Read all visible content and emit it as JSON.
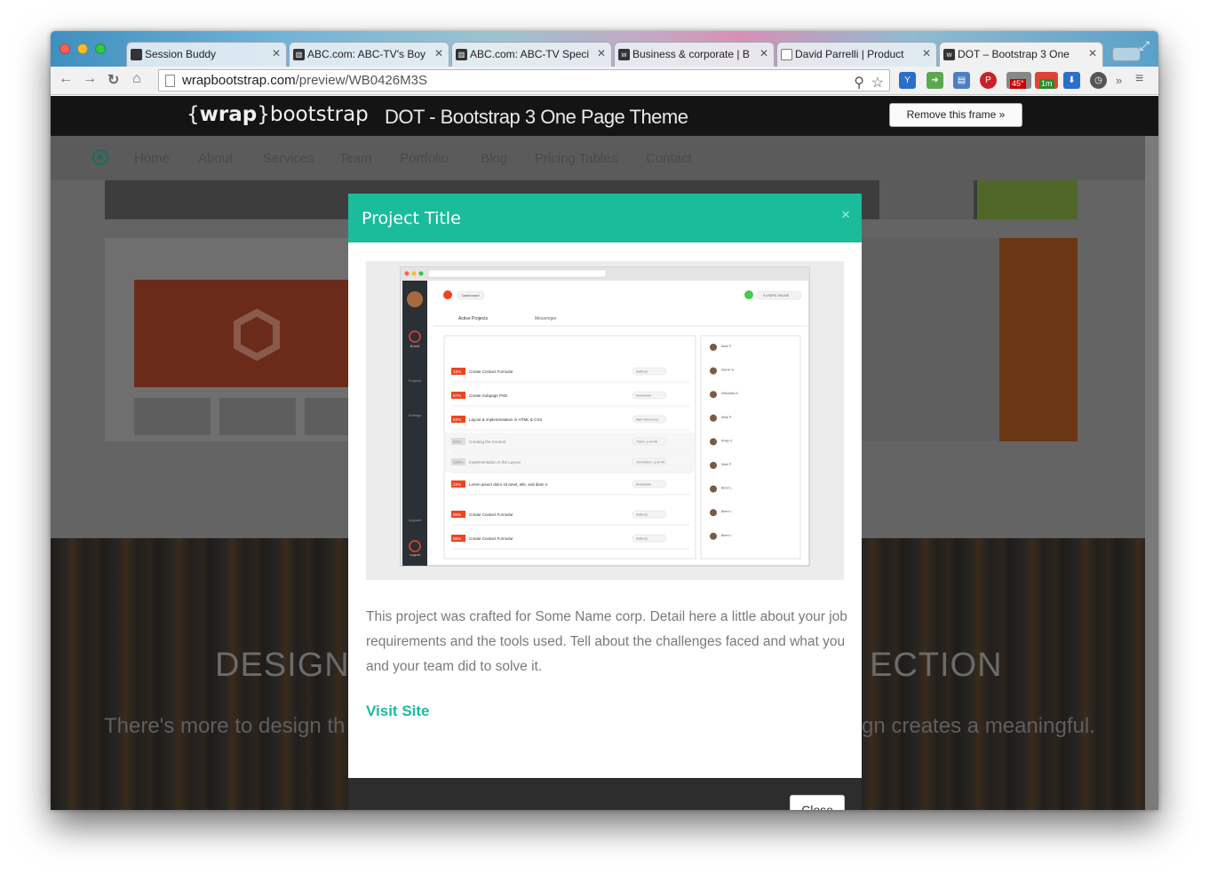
{
  "browser": {
    "tabs": [
      {
        "title": "Session Buddy",
        "icon": "session-icon"
      },
      {
        "title": "ABC.com: ABC-TV's Boy",
        "icon": "columns-icon"
      },
      {
        "title": "ABC.com: ABC-TV Speci",
        "icon": "columns-icon"
      },
      {
        "title": "Business & corporate | B",
        "icon": "wrap-icon"
      },
      {
        "title": "David Parrelli | Product",
        "icon": "doc-icon"
      },
      {
        "title": "DOT – Bootstrap 3 One",
        "icon": "wrap-icon"
      }
    ],
    "url_host": "wrapbootstrap.com",
    "url_path": "/preview/WB0426M3S",
    "ext_badges": {
      "weather": "45°",
      "timer": "1m"
    }
  },
  "wrap": {
    "logo_brace_open": "{",
    "logo_bold": "wrap",
    "logo_brace_close": "}",
    "logo_rest": "bootstrap",
    "title": "DOT - Bootstrap 3 One Page Theme",
    "remove_frame": "Remove this frame »"
  },
  "site": {
    "nav": [
      "Home",
      "About",
      "Services",
      "Team",
      "Portfolio",
      "Blog",
      "Pricing Tables",
      "Contact"
    ],
    "hero_heading_left": "DESIGN",
    "hero_heading_right": "ECTION",
    "hero_text_left": "There's more to design th",
    "hero_text_right": "gn creates a meaningful."
  },
  "modal": {
    "title": "Project Title",
    "close_x": "×",
    "description": "This project was crafted for Some Name corp. Detail here a little about your job requirements and the tools used. Tell about the challenges faced and what you and your team did to solve it.",
    "visit_label": "Visit Site",
    "close_label": "Close"
  },
  "screenshot": {
    "sidebar": [
      "Board",
      "Projects",
      "Settings",
      "Upgrade",
      "Logout"
    ],
    "tab_dashboard": "Dashboard",
    "tab_active": "Active Projects",
    "tab_messenger": "Messenger",
    "rows": [
      {
        "pct": "23%",
        "name": "Create Contact Formular",
        "tag": "WORLDS"
      },
      {
        "pct": "87%",
        "name": "Create Subpage PSD",
        "tag": "PANORAMA"
      },
      {
        "pct": "83%",
        "name": "Layout & implementation in HTML & CSS",
        "tag": "EBAY RELAUNCH"
      },
      {
        "pct": "80%",
        "name": "Creating the Context",
        "tag": "TODAY, 12:45 PM"
      },
      {
        "pct": "100%",
        "name": "Implementation in the Layout",
        "tag": "YESTERDAY, 12:42 PM"
      },
      {
        "pct": "23%",
        "name": "Lorem ipsum dolor sit amet, elitr, sed diam nonumy eirmod tempor",
        "tag": "PANORAMA"
      },
      {
        "pct": "98%",
        "name": "Create Contact Formular",
        "tag": "WORLDS"
      },
      {
        "pct": "98%",
        "name": "Create Contact Formular",
        "tag": "WORLDS"
      }
    ],
    "activity": [
      "Mark P.",
      "Marvin S.",
      "Sebastian K.",
      "Mark P.",
      "Philip O.",
      "Mark P.",
      "Benni L.",
      "Benni L.",
      "Benni L."
    ],
    "online": "5 USERS ONLINE"
  }
}
